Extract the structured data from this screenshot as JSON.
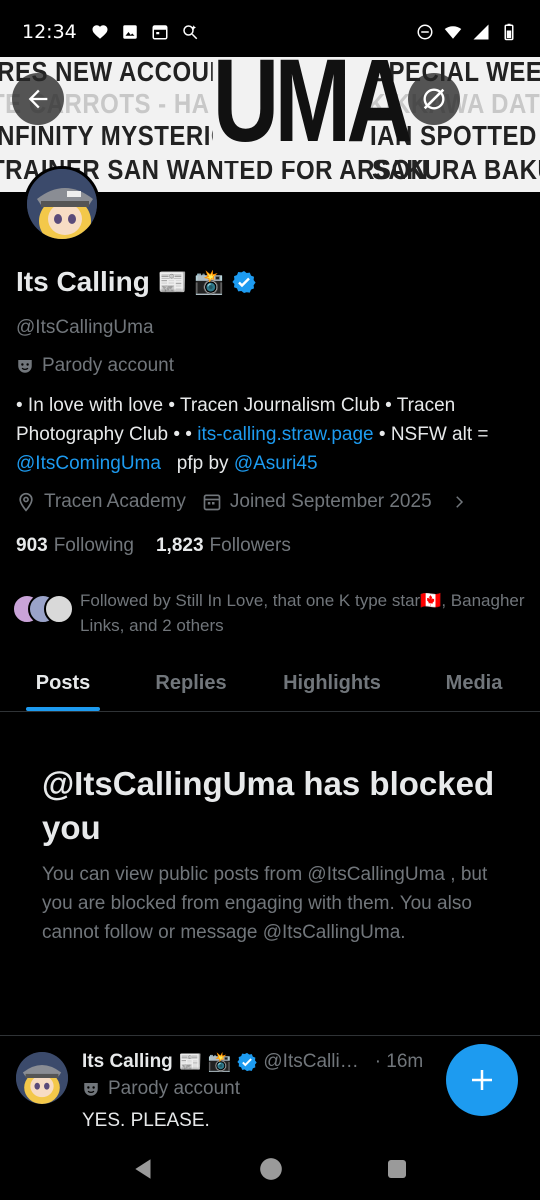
{
  "status_bar": {
    "time": "12:34"
  },
  "banner": {
    "rows": [
      "IRES NEW ACCOUN",
      "TE CARROTS - HA",
      "INFINITY MYSTERIO",
      "TRAINER SAN WANTED FOR ARSON"
    ],
    "right_rows": [
      "SPECIAL WEEK EATS",
      "KIKKAWA DATING?",
      "IAN SPOTTED - SPICA",
      "SAKURA BAKUSHIN"
    ],
    "center_word": "UMA"
  },
  "profile": {
    "name": "Its Calling",
    "name_emojis": "📰 📸",
    "handle": "@ItsCallingUma",
    "parody_label": "Parody account",
    "bio_line1": "• In love with love • Tracen Journalism Club • Tracen Photography Club •  • ",
    "bio_link": "its-calling.straw.page",
    "bio_mid": " •  NSFW alt = ",
    "bio_mention1": "@ItsComingUma",
    "bio_mid2": "   pfp by ",
    "bio_mention2": "@Asuri45",
    "location": "Tracen Academy",
    "joined": "Joined September 2025",
    "following_count": "903",
    "following_label": "Following",
    "followers_count": "1,823",
    "followers_label": "Followers",
    "followed_by": "Followed by Still In Love, that one K type star🇨🇦, Banagher Links, and 2 others"
  },
  "tabs": [
    {
      "label": "Posts",
      "active": true
    },
    {
      "label": "Replies",
      "active": false
    },
    {
      "label": "Highlights",
      "active": false
    },
    {
      "label": "Media",
      "active": false
    }
  ],
  "blocked": {
    "title": "@ItsCallingUma has blocked you",
    "body": "You can view public posts from @ItsCallingUma , but you are blocked from engaging with them. You also cannot follow or message @ItsCallingUma."
  },
  "post": {
    "name": "Its Calling",
    "emojis": "📰 📸",
    "handle": "@ItsCalli…",
    "time": "· 16m",
    "parody_label": "Parody account",
    "text": "YES. PLEASE."
  },
  "colors": {
    "accent": "#1d9bf0",
    "background": "#000000",
    "muted": "#71767b"
  }
}
